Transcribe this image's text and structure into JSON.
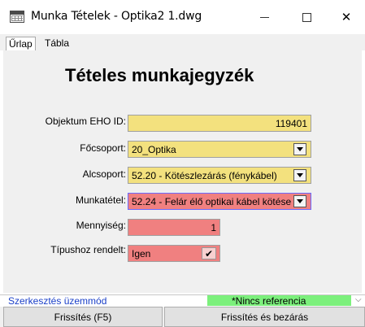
{
  "window": {
    "title": "Munka Tételek - Optika2 1.dwg",
    "minimize_icon": "minimize-icon",
    "maximize_icon": "maximize-icon",
    "close_icon": "close-icon",
    "close_glyph": "✕"
  },
  "tabs": [
    {
      "label": "Űrlap",
      "active": true
    },
    {
      "label": "Tábla",
      "active": false
    }
  ],
  "form": {
    "heading": "Tételes munkajegyzék",
    "fields": {
      "objektum": {
        "label": "Objektum EHO ID:",
        "value": "119401"
      },
      "focsoport": {
        "label": "Főcsoport:",
        "value": "20_Optika"
      },
      "alcsoport": {
        "label": "Alcsoport:",
        "value": "52.20 - Kötészlezárás (fénykábel)"
      },
      "munkatetel": {
        "label": "Munkatétel:",
        "value": "52.24 - Felár élő optikai kábel kötése"
      },
      "mennyiseg": {
        "label": "Mennyiség:",
        "value": "1"
      },
      "tipushoz": {
        "label": "Típushoz rendelt:",
        "value": "Igen",
        "check_glyph": "✔"
      }
    },
    "colors": {
      "yellow_field": "#f3e17e",
      "red_field": "#f08080"
    }
  },
  "status": {
    "mode": "Szerkesztés üzemmód",
    "reference": "*Nincs referencia",
    "chevron": "⌵",
    "mode_color": "#1a3fc8",
    "reference_bg": "#7cf07c"
  },
  "buttons": {
    "refresh": "Frissítés (F5)",
    "refresh_close": "Frissítés és bezárás"
  }
}
